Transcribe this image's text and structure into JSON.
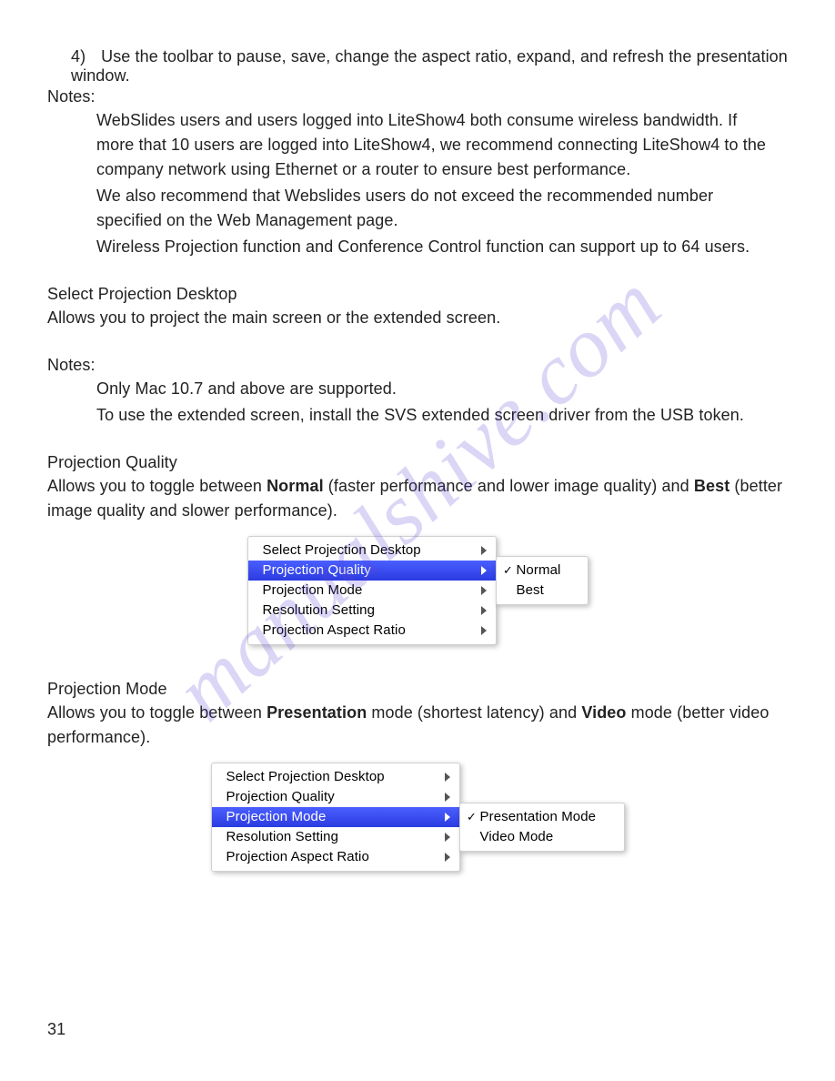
{
  "watermark": "manualshive.com",
  "step4": {
    "num": "4)",
    "text": "Use the toolbar to pause, save, change the aspect ratio, expand, and refresh the presentation window."
  },
  "notes1_label": "Notes:",
  "notes1": {
    "p1": "WebSlides users and users logged into LiteShow4 both consume wireless bandwidth. If more that 10 users are logged into LiteShow4, we recommend connecting LiteShow4 to the company network using Ethernet or a router to ensure best performance.",
    "p2": "We also recommend that Webslides users do not exceed the recommended number specified on the Web Management page.",
    "p3": "Wireless Projection function and Conference Control function can support up to 64 users."
  },
  "spd": {
    "title": "Select Projection Desktop",
    "desc": "Allows you to project the main screen or the extended screen."
  },
  "notes2_label": "Notes:",
  "notes2": {
    "p1": "Only Mac 10.7 and above are supported.",
    "p2": "To use the extended screen, install the SVS extended screen driver from the USB token."
  },
  "pq": {
    "title": "Projection Quality",
    "desc_pre": "Allows you to toggle between ",
    "bold1": "Normal",
    "mid": " (faster performance and lower image quality) and ",
    "bold2": "Best",
    "post": " (better image quality and slower performance)."
  },
  "pm": {
    "title": "Projection Mode",
    "desc_pre": "Allows you to toggle between ",
    "bold1": "Presentation",
    "mid": " mode (shortest latency) and ",
    "bold2": "Video",
    "post": " mode (better video performance)."
  },
  "menu1": {
    "main": {
      "i0": "Select Projection Desktop",
      "i1": "Projection Quality",
      "i2": "Projection Mode",
      "i3": "Resolution Setting",
      "i4": "Projection Aspect Ratio"
    },
    "sub": {
      "i0": "Normal",
      "i1": "Best"
    }
  },
  "menu2": {
    "main": {
      "i0": "Select Projection Desktop",
      "i1": "Projection Quality",
      "i2": "Projection Mode",
      "i3": "Resolution Setting",
      "i4": "Projection Aspect Ratio"
    },
    "sub": {
      "i0": "Presentation Mode",
      "i1": "Video Mode"
    }
  },
  "page_number": "31"
}
